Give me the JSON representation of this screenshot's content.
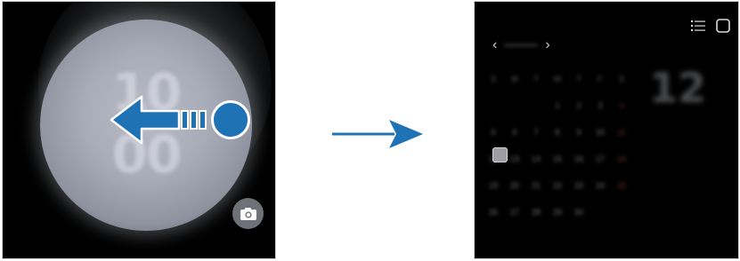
{
  "left_screen": {
    "clock": {
      "hour": "10",
      "minute": "00",
      "date": ""
    },
    "icons": {
      "camera": "camera-icon",
      "swipe_arrow": "arrow-left-icon"
    }
  },
  "transition": {
    "icon": "arrow-right-icon"
  },
  "right_screen": {
    "header_icons": [
      "list-view-icon",
      "square-view-icon"
    ],
    "nav": {
      "prev": "‹",
      "next": "›",
      "month": ""
    },
    "calendar": {
      "rows": [
        [
          "S",
          "M",
          "T",
          "W",
          "T",
          "F",
          "S"
        ],
        [
          "",
          "",
          "",
          "1",
          "2",
          "3",
          "4"
        ],
        [
          "5",
          "6",
          "7",
          "8",
          "9",
          "10",
          "11"
        ],
        [
          "12",
          "13",
          "14",
          "15",
          "16",
          "17",
          "18"
        ],
        [
          "19",
          "20",
          "21",
          "22",
          "23",
          "24",
          "25"
        ],
        [
          "26",
          "27",
          "28",
          "29",
          "30",
          "",
          ""
        ]
      ]
    },
    "selected_day": "12",
    "events": [
      "",
      ""
    ]
  },
  "colors": {
    "accent": "#1f72b3",
    "screen_bg": "#000000",
    "sphere": "#a8acb8"
  }
}
